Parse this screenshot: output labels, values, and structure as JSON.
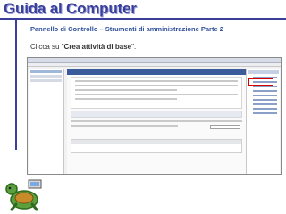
{
  "header": {
    "title": "Guida al Computer"
  },
  "subtitle": "Pannello di Controllo – Strumenti di amministrazione Parte 2",
  "instruction": {
    "prefix": "Clicca su \"",
    "highlight": "Crea attività di base",
    "suffix": "\"."
  },
  "colors": {
    "title": "#3a3f9a",
    "subtitle": "#2d4f9a",
    "highlight_box": "#d40000"
  },
  "icons": {
    "logo": "turtle-logo-icon"
  }
}
